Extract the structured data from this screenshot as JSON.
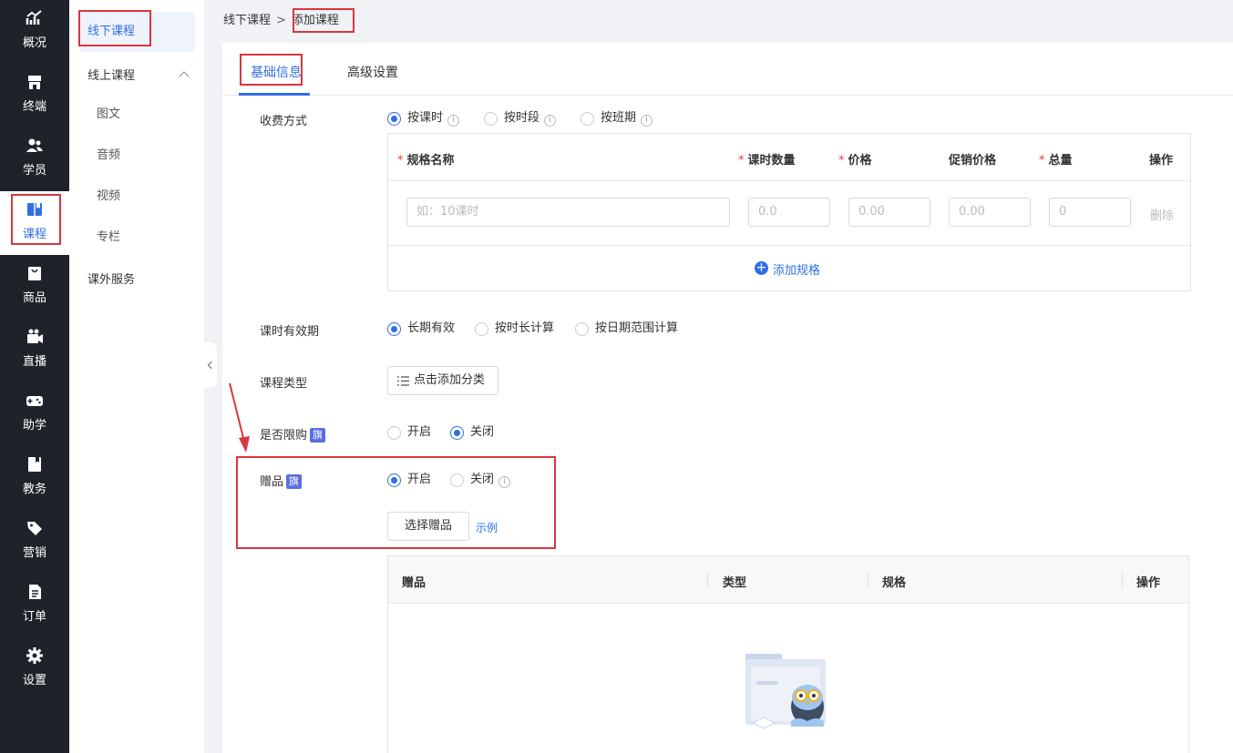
{
  "leftnav": {
    "items": [
      {
        "label": "概况",
        "icon": "chart-icon"
      },
      {
        "label": "终端",
        "icon": "store-icon"
      },
      {
        "label": "学员",
        "icon": "users-icon"
      },
      {
        "label": "课程",
        "icon": "book-icon"
      },
      {
        "label": "商品",
        "icon": "bag-icon"
      },
      {
        "label": "直播",
        "icon": "video-icon"
      },
      {
        "label": "助学",
        "icon": "gamepad-icon"
      },
      {
        "label": "教务",
        "icon": "notebook-icon"
      },
      {
        "label": "营销",
        "icon": "tag-icon"
      },
      {
        "label": "订单",
        "icon": "document-icon"
      },
      {
        "label": "设置",
        "icon": "gear-icon"
      }
    ]
  },
  "subnav": {
    "offline": "线下课程",
    "online": "线上课程",
    "children": [
      "图文",
      "音频",
      "视频",
      "专栏"
    ],
    "extra": "课外服务"
  },
  "breadcrumb": {
    "parent": "线下课程",
    "sep": ">",
    "current": "添加课程"
  },
  "tabs": {
    "basic": "基础信息",
    "advanced": "高级设置"
  },
  "form": {
    "charge_label": "收费方式",
    "charge_options": [
      "按课时",
      "按时段",
      "按班期"
    ],
    "spec": {
      "headers": {
        "name": "规格名称",
        "hours": "课时数量",
        "price": "价格",
        "promo": "促销价格",
        "total": "总量",
        "action": "操作"
      },
      "required_mark": "*",
      "placeholders": {
        "name": "如：10课时",
        "hours": "0.0",
        "price": "0.00",
        "promo": "0.00",
        "total": "0"
      },
      "delete": "删除",
      "add": "添加规格"
    },
    "validity_label": "课时有效期",
    "validity_options": [
      "长期有效",
      "按时长计算",
      "按日期范围计算"
    ],
    "type_label": "课程类型",
    "type_button": "点击添加分类",
    "limit_label": "是否限购",
    "flag_badge": "旗",
    "limit_options": [
      "开启",
      "关闭"
    ],
    "gift_label": "赠品",
    "gift_options": [
      "开启",
      "关闭"
    ],
    "gift_select": "选择赠品",
    "gift_example": "示例",
    "gift_table": {
      "headers": [
        "赠品",
        "类型",
        "规格",
        "操作"
      ]
    }
  },
  "colors": {
    "accent": "#2f6fe4",
    "nav_bg": "#1f2329",
    "highlight_red": "#d9363e"
  }
}
